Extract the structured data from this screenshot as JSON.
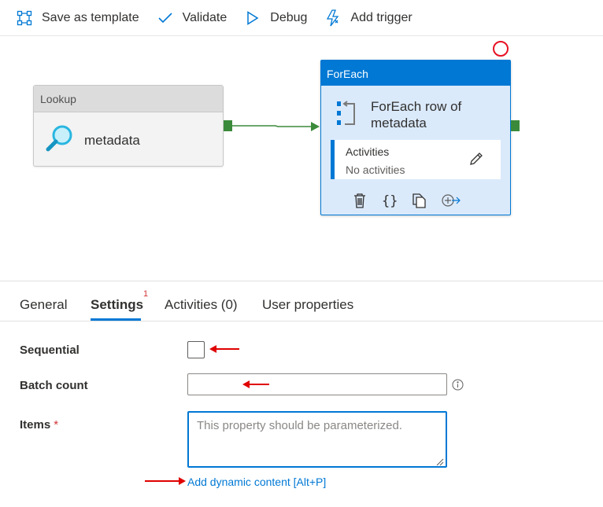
{
  "toolbar": {
    "save_template": "Save as template",
    "validate": "Validate",
    "debug": "Debug",
    "add_trigger": "Add trigger"
  },
  "canvas": {
    "lookup": {
      "header": "Lookup",
      "name": "metadata"
    },
    "foreach": {
      "header": "ForEach",
      "title": "ForEach row of metadata",
      "activities_label": "Activities",
      "activities_value": "No activities"
    }
  },
  "tabs": [
    {
      "label": "General",
      "active": false
    },
    {
      "label": "Settings",
      "active": true,
      "badge": "1"
    },
    {
      "label": "Activities (0)",
      "active": false
    },
    {
      "label": "User properties",
      "active": false
    }
  ],
  "settings": {
    "sequential_label": "Sequential",
    "sequential_checked": false,
    "batch_count_label": "Batch count",
    "batch_count_value": "",
    "items_label": "Items",
    "items_required_marker": "*",
    "items_placeholder": "This property should be parameterized.",
    "dynamic_content_link": "Add dynamic content [Alt+P]"
  },
  "colors": {
    "accent": "#0078d4",
    "success_port": "#3b8a3b",
    "annotation_red": "#e81123"
  }
}
